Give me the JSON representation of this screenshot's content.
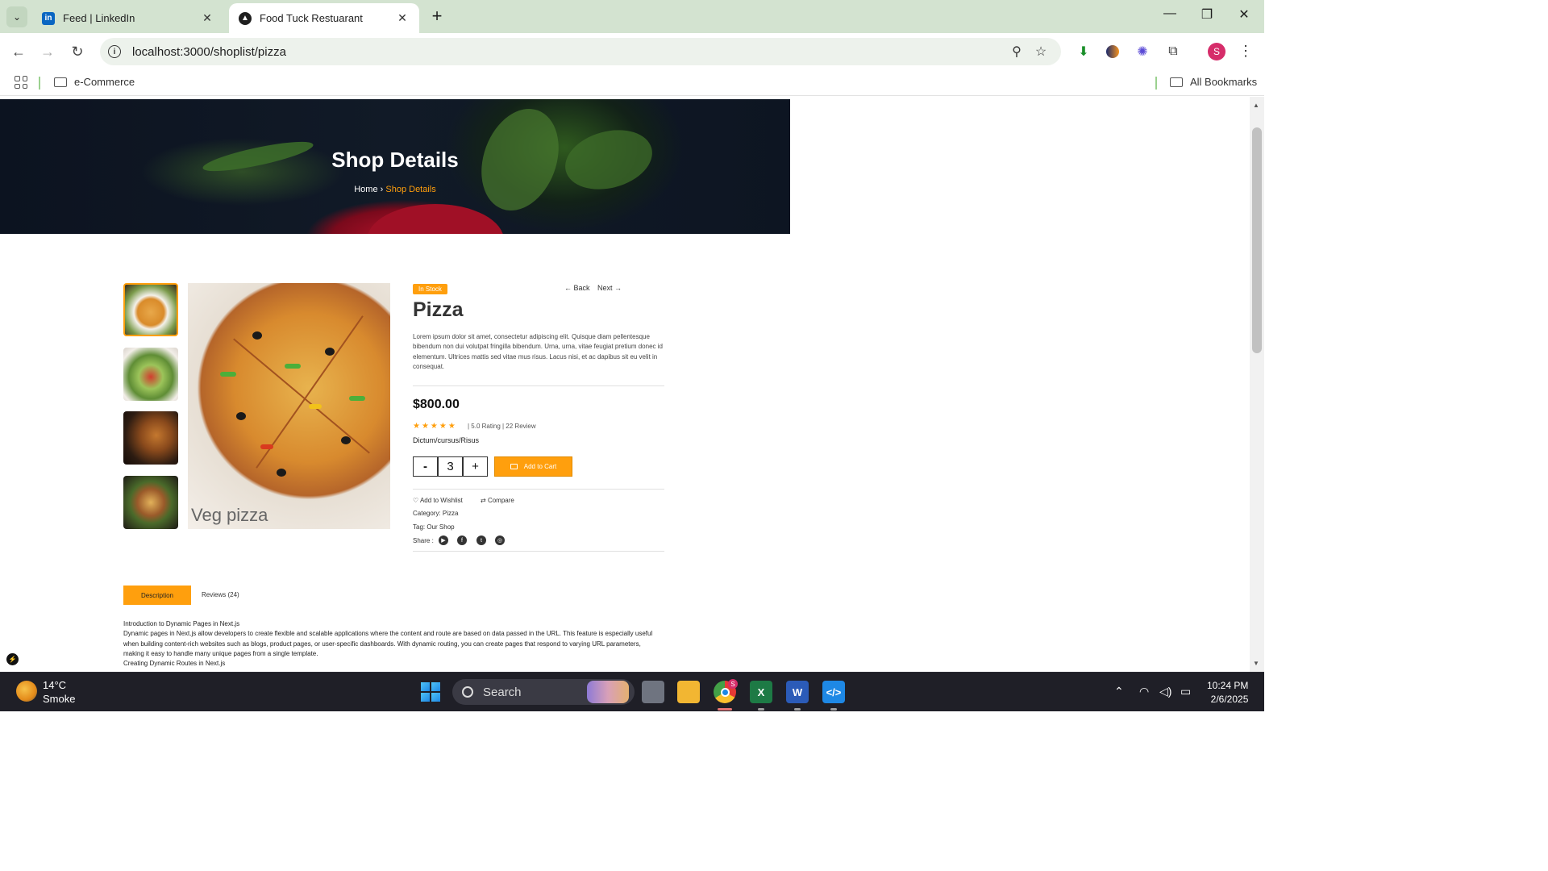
{
  "browser": {
    "tabs": [
      {
        "title": "Feed | LinkedIn",
        "favicon": "linkedin-icon"
      },
      {
        "title": "Food Tuck Restuarant",
        "favicon": "triangle-logo-icon"
      }
    ],
    "url": "localhost:3000/shoplist/pizza",
    "bookmarks": {
      "folder": "e-Commerce",
      "all": "All Bookmarks"
    },
    "profile_initial": "S"
  },
  "hero": {
    "title": "Shop Details",
    "breadcrumb_home": "Home",
    "breadcrumb_sep": "›",
    "breadcrumb_current": "Shop Details"
  },
  "product": {
    "badge": "In Stock",
    "back": "Back",
    "next": "Next",
    "name": "Pizza",
    "description": "Lorem ipsum dolor sit amet, consectetur adipiscing elit. Quisque diam pellentesque bibendum non dui volutpat fringilla bibendum. Urna, urna, vitae feugiat pretium donec id elementum. Ultrices mattis sed vitae mus risus. Lacus nisi, et ac dapibus sit eu velit in consequat.",
    "price": "$800.00",
    "stars": "★★★★★",
    "rating_value": 5,
    "rating_text": "|  5.0 Rating |  22 Review",
    "dictum": "Dictum/cursus/Risus",
    "qty_minus": "-",
    "quantity": "3",
    "qty_plus": "+",
    "add_to_cart": "Add to Cart",
    "wishlist": "Add to Wishlist",
    "compare": "Compare",
    "category_label": "Category:",
    "category": "Pizza",
    "tag_label": "Tag:",
    "tag": "Our Shop",
    "share_label": "Share :",
    "image_caption": "Veg pizza"
  },
  "tabs": {
    "description": "Description",
    "reviews": "Reviews (24)"
  },
  "description_body": {
    "line1": "Introduction to Dynamic Pages in Next.js",
    "line2": "Dynamic pages in Next.js allow developers to create flexible and scalable applications where the content and route are based on data passed in the URL. This feature is especially useful when building content-rich websites such as blogs, product pages, or user-specific dashboards. With dynamic routing, you can create pages that respond to varying URL parameters, making it easy to handle many unique pages from a single template.",
    "line3": "Creating Dynamic Routes in Next.js"
  },
  "taskbar": {
    "temp": "14°C",
    "weather": "Smoke",
    "search": "Search",
    "time": "10:24 PM",
    "date": "2/6/2025",
    "chrome_badge": "S"
  },
  "colors": {
    "accent": "#ff9f0d",
    "tabbar": "#d3e3d0",
    "hero_bg": "#0f1724",
    "taskbar": "#1f1f27"
  }
}
